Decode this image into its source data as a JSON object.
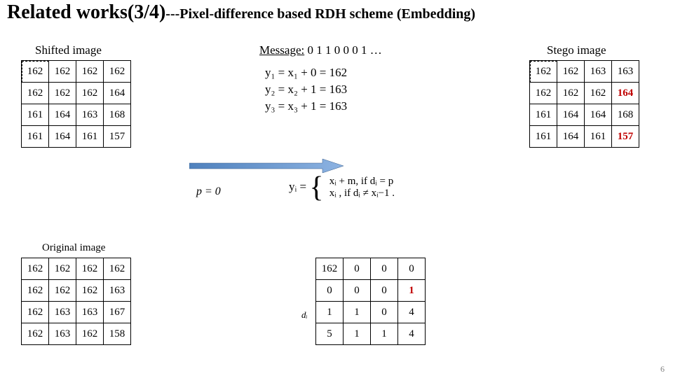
{
  "title_main": "Related works(3/4)",
  "title_sub": "---Pixel-difference based RDH scheme (Embedding)",
  "labels": {
    "shifted": "Shifted image",
    "stego": "Stego image",
    "original": "Original image",
    "message_prefix": "Message:",
    "message_bits": "0 1 1 0 0 0 1 …",
    "p_eq": "p = 0",
    "di": "dᵢ"
  },
  "equations": {
    "y1": "y₁ = x₁ + 0 = 162",
    "y2": "y₂ = x₂ + 1 = 163",
    "y3": "y₃ = x₃ + 1 = 163"
  },
  "formula": {
    "lhs": "yᵢ =",
    "line1": "xᵢ + m,  if dᵢ = p",
    "line2": "xᵢ ,  if dᵢ ≠ xᵢ−1 ."
  },
  "shifted_image": [
    [
      "162",
      "162",
      "162",
      "162"
    ],
    [
      "162",
      "162",
      "162",
      "164"
    ],
    [
      "161",
      "164",
      "163",
      "168"
    ],
    [
      "161",
      "164",
      "161",
      "157"
    ]
  ],
  "stego_image": [
    [
      "162",
      "162",
      "163",
      "163"
    ],
    [
      "162",
      "162",
      "162",
      "164"
    ],
    [
      "161",
      "164",
      "164",
      "168"
    ],
    [
      "161",
      "164",
      "161",
      "157"
    ]
  ],
  "stego_red": [
    [
      1,
      3
    ],
    [
      3,
      3
    ]
  ],
  "original_image": [
    [
      "162",
      "162",
      "162",
      "162"
    ],
    [
      "162",
      "162",
      "162",
      "163"
    ],
    [
      "162",
      "163",
      "163",
      "167"
    ],
    [
      "162",
      "163",
      "162",
      "158"
    ]
  ],
  "difference": [
    [
      "162",
      "0",
      "0",
      "0"
    ],
    [
      "0",
      "0",
      "0",
      "1"
    ],
    [
      "1",
      "1",
      "0",
      "4"
    ],
    [
      "5",
      "1",
      "1",
      "4"
    ]
  ],
  "diff_red": [
    [
      1,
      3
    ]
  ],
  "page_number": "6"
}
